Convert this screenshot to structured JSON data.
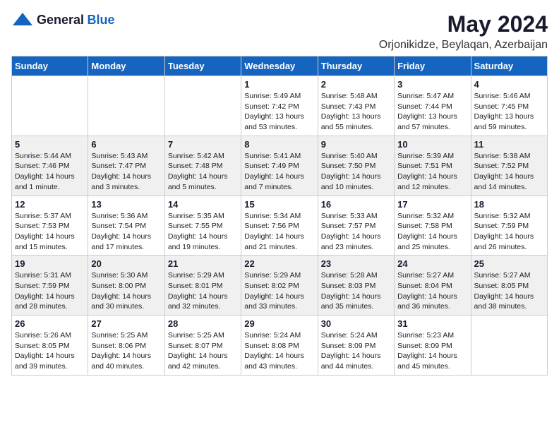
{
  "logo": {
    "general": "General",
    "blue": "Blue"
  },
  "title": "May 2024",
  "subtitle": "Orjonikidze, Beylaqan, Azerbaijan",
  "headers": [
    "Sunday",
    "Monday",
    "Tuesday",
    "Wednesday",
    "Thursday",
    "Friday",
    "Saturday"
  ],
  "weeks": [
    [
      {
        "day": "",
        "info": ""
      },
      {
        "day": "",
        "info": ""
      },
      {
        "day": "",
        "info": ""
      },
      {
        "day": "1",
        "info": "Sunrise: 5:49 AM\nSunset: 7:42 PM\nDaylight: 13 hours and 53 minutes."
      },
      {
        "day": "2",
        "info": "Sunrise: 5:48 AM\nSunset: 7:43 PM\nDaylight: 13 hours and 55 minutes."
      },
      {
        "day": "3",
        "info": "Sunrise: 5:47 AM\nSunset: 7:44 PM\nDaylight: 13 hours and 57 minutes."
      },
      {
        "day": "4",
        "info": "Sunrise: 5:46 AM\nSunset: 7:45 PM\nDaylight: 13 hours and 59 minutes."
      }
    ],
    [
      {
        "day": "5",
        "info": "Sunrise: 5:44 AM\nSunset: 7:46 PM\nDaylight: 14 hours and 1 minute."
      },
      {
        "day": "6",
        "info": "Sunrise: 5:43 AM\nSunset: 7:47 PM\nDaylight: 14 hours and 3 minutes."
      },
      {
        "day": "7",
        "info": "Sunrise: 5:42 AM\nSunset: 7:48 PM\nDaylight: 14 hours and 5 minutes."
      },
      {
        "day": "8",
        "info": "Sunrise: 5:41 AM\nSunset: 7:49 PM\nDaylight: 14 hours and 7 minutes."
      },
      {
        "day": "9",
        "info": "Sunrise: 5:40 AM\nSunset: 7:50 PM\nDaylight: 14 hours and 10 minutes."
      },
      {
        "day": "10",
        "info": "Sunrise: 5:39 AM\nSunset: 7:51 PM\nDaylight: 14 hours and 12 minutes."
      },
      {
        "day": "11",
        "info": "Sunrise: 5:38 AM\nSunset: 7:52 PM\nDaylight: 14 hours and 14 minutes."
      }
    ],
    [
      {
        "day": "12",
        "info": "Sunrise: 5:37 AM\nSunset: 7:53 PM\nDaylight: 14 hours and 15 minutes."
      },
      {
        "day": "13",
        "info": "Sunrise: 5:36 AM\nSunset: 7:54 PM\nDaylight: 14 hours and 17 minutes."
      },
      {
        "day": "14",
        "info": "Sunrise: 5:35 AM\nSunset: 7:55 PM\nDaylight: 14 hours and 19 minutes."
      },
      {
        "day": "15",
        "info": "Sunrise: 5:34 AM\nSunset: 7:56 PM\nDaylight: 14 hours and 21 minutes."
      },
      {
        "day": "16",
        "info": "Sunrise: 5:33 AM\nSunset: 7:57 PM\nDaylight: 14 hours and 23 minutes."
      },
      {
        "day": "17",
        "info": "Sunrise: 5:32 AM\nSunset: 7:58 PM\nDaylight: 14 hours and 25 minutes."
      },
      {
        "day": "18",
        "info": "Sunrise: 5:32 AM\nSunset: 7:59 PM\nDaylight: 14 hours and 26 minutes."
      }
    ],
    [
      {
        "day": "19",
        "info": "Sunrise: 5:31 AM\nSunset: 7:59 PM\nDaylight: 14 hours and 28 minutes."
      },
      {
        "day": "20",
        "info": "Sunrise: 5:30 AM\nSunset: 8:00 PM\nDaylight: 14 hours and 30 minutes."
      },
      {
        "day": "21",
        "info": "Sunrise: 5:29 AM\nSunset: 8:01 PM\nDaylight: 14 hours and 32 minutes."
      },
      {
        "day": "22",
        "info": "Sunrise: 5:29 AM\nSunset: 8:02 PM\nDaylight: 14 hours and 33 minutes."
      },
      {
        "day": "23",
        "info": "Sunrise: 5:28 AM\nSunset: 8:03 PM\nDaylight: 14 hours and 35 minutes."
      },
      {
        "day": "24",
        "info": "Sunrise: 5:27 AM\nSunset: 8:04 PM\nDaylight: 14 hours and 36 minutes."
      },
      {
        "day": "25",
        "info": "Sunrise: 5:27 AM\nSunset: 8:05 PM\nDaylight: 14 hours and 38 minutes."
      }
    ],
    [
      {
        "day": "26",
        "info": "Sunrise: 5:26 AM\nSunset: 8:05 PM\nDaylight: 14 hours and 39 minutes."
      },
      {
        "day": "27",
        "info": "Sunrise: 5:25 AM\nSunset: 8:06 PM\nDaylight: 14 hours and 40 minutes."
      },
      {
        "day": "28",
        "info": "Sunrise: 5:25 AM\nSunset: 8:07 PM\nDaylight: 14 hours and 42 minutes."
      },
      {
        "day": "29",
        "info": "Sunrise: 5:24 AM\nSunset: 8:08 PM\nDaylight: 14 hours and 43 minutes."
      },
      {
        "day": "30",
        "info": "Sunrise: 5:24 AM\nSunset: 8:09 PM\nDaylight: 14 hours and 44 minutes."
      },
      {
        "day": "31",
        "info": "Sunrise: 5:23 AM\nSunset: 8:09 PM\nDaylight: 14 hours and 45 minutes."
      },
      {
        "day": "",
        "info": ""
      }
    ]
  ]
}
